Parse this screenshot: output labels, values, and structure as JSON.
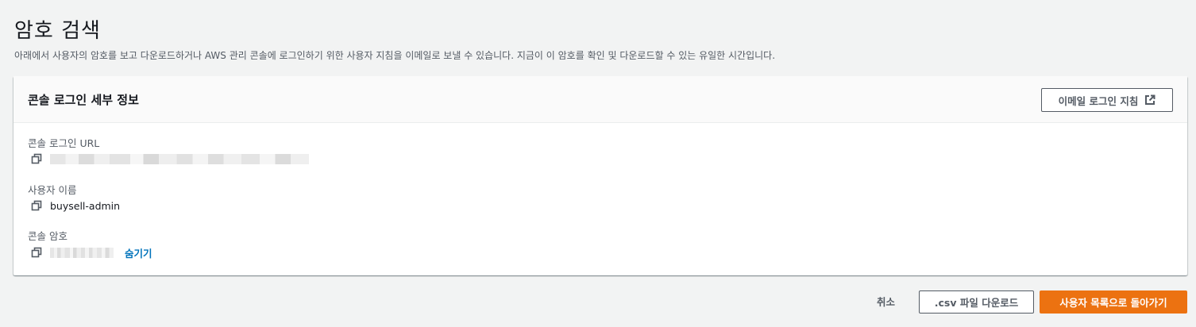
{
  "page": {
    "title": "암호 검색",
    "description": "아래에서 사용자의 암호를 보고 다운로드하거나 AWS 관리 콘솔에 로그인하기 위한 사용자 지침을 이메일로 보낼 수 있습니다. 지금이 이 암호를 확인 및 다운로드할 수 있는 유일한 시간입니다."
  },
  "panel": {
    "title": "콘솔 로그인 세부 정보",
    "email_button": {
      "label": "이메일 로그인 지침",
      "icon": "external-link-icon"
    },
    "fields": {
      "url": {
        "label": "콘솔 로그인 URL",
        "copy_icon": "copy-icon"
      },
      "username": {
        "label": "사용자 이름",
        "value": "buysell-admin",
        "copy_icon": "copy-icon"
      },
      "password": {
        "label": "콘솔 암호",
        "hide_label": "숨기기",
        "copy_icon": "copy-icon"
      }
    }
  },
  "footer": {
    "cancel_label": "취소",
    "csv_label": ".csv 파일 다운로드",
    "return_label": "사용자 목록으로 돌아가기"
  },
  "colors": {
    "background": "#f2f3f3",
    "primary": "#ec7211",
    "link": "#0073bb",
    "text": "#16191f",
    "muted": "#545b64"
  }
}
